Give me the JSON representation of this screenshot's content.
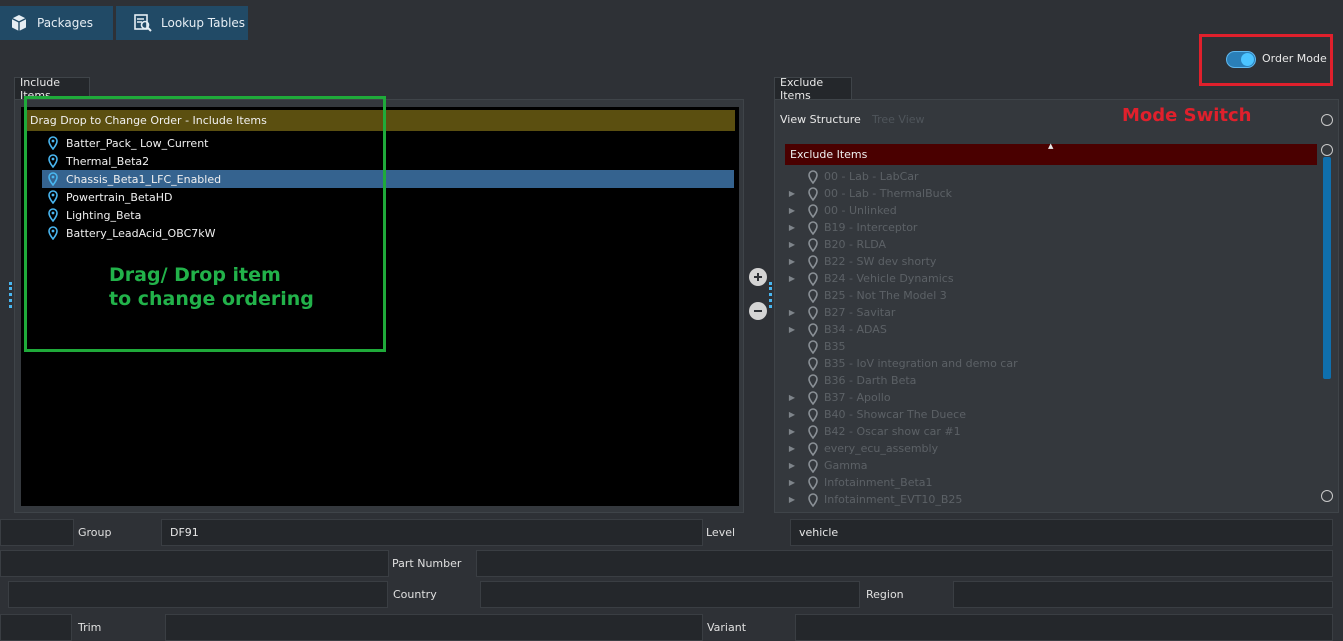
{
  "top_tabs": [
    {
      "label": "Packages",
      "icon": "package-icon"
    },
    {
      "label": "Lookup Tables",
      "icon": "lookup-table-icon"
    }
  ],
  "order_mode": {
    "label": "Order Mode",
    "enabled": true
  },
  "annotations": {
    "mode_switch": "Mode Switch",
    "drag_line1": "Drag/ Drop item",
    "drag_line2": "to change ordering"
  },
  "include": {
    "tab_label": "Include Items",
    "header": "Drag Drop to Change Order - Include Items",
    "items": [
      "Batter_Pack_ Low_Current",
      "Thermal_Beta2",
      "Chassis_Beta1_LFC_Enabled",
      "Powertrain_BetaHD",
      "Lighting_Beta",
      "Battery_LeadAcid_OBC7kW"
    ],
    "selected_index": 2
  },
  "exclude": {
    "tab_label": "Exclude Items",
    "view_structure": "View Structure",
    "tree_view": "Tree View",
    "header": "Exclude Items",
    "items": [
      {
        "label": "00 - Lab - LabCar",
        "expandable": false
      },
      {
        "label": "00 - Lab - ThermalBuck",
        "expandable": true
      },
      {
        "label": "00 - Unlinked",
        "expandable": true
      },
      {
        "label": "B19 - Interceptor",
        "expandable": true
      },
      {
        "label": "B20 - RLDA",
        "expandable": true
      },
      {
        "label": "B22 - SW dev shorty",
        "expandable": true
      },
      {
        "label": "B24 - Vehicle Dynamics",
        "expandable": true
      },
      {
        "label": "B25 - Not The Model 3",
        "expandable": false
      },
      {
        "label": "B27 - Savitar",
        "expandable": true
      },
      {
        "label": "B34 - ADAS",
        "expandable": true
      },
      {
        "label": "B35",
        "expandable": false
      },
      {
        "label": "B35 - IoV integration and demo car",
        "expandable": false
      },
      {
        "label": "B36 - Darth Beta",
        "expandable": false
      },
      {
        "label": "B37 - Apollo",
        "expandable": true
      },
      {
        "label": "B40 - Showcar The Duece",
        "expandable": true
      },
      {
        "label": "B42 - Oscar show car #1",
        "expandable": true
      },
      {
        "label": "every_ecu_assembly",
        "expandable": true
      },
      {
        "label": "Gamma",
        "expandable": true
      },
      {
        "label": "Infotainment_Beta1",
        "expandable": true
      },
      {
        "label": "Infotainment_EVT10_B25",
        "expandable": true
      }
    ]
  },
  "form": {
    "group_label": "Group",
    "group_value": "DF91",
    "level_label": "Level",
    "level_value": "vehicle",
    "part_number_label": "Part Number",
    "part_number_value": "",
    "country_label": "Country",
    "country_value": "",
    "region_label": "Region",
    "region_value": "",
    "trim_label": "Trim",
    "variant_label": "Variant"
  },
  "colors": {
    "accent": "#2a7fb8",
    "include_header": "#5b4f10",
    "exclude_header": "#4a0000",
    "selection": "#35638f",
    "annotation_green": "#22b24a",
    "annotation_red": "#e0202c"
  }
}
